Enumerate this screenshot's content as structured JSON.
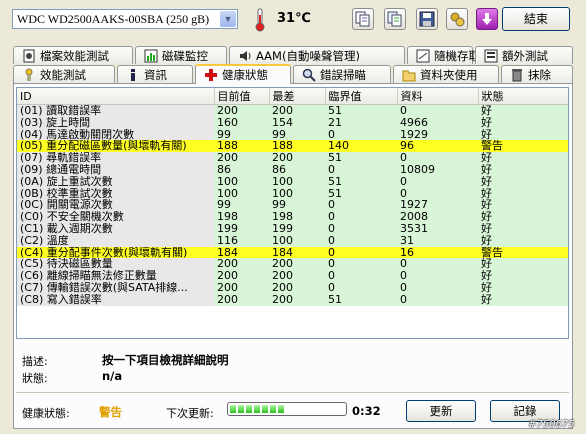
{
  "toolbar": {
    "drive": "WDC WD2500AAKS-00SBA     (250 gB)",
    "temperature": "31℃",
    "exit_label": "結束"
  },
  "tabs_row1": [
    {
      "label": "檔案效能測試",
      "icon": "file-speed-icon"
    },
    {
      "label": "磁碟監控",
      "icon": "disk-monitor-icon"
    },
    {
      "label": "AAM(自動噪聲管理)",
      "icon": "speaker-icon"
    },
    {
      "label": "隨機存取",
      "icon": "random-access-icon"
    },
    {
      "label": "額外測試",
      "icon": "extra-test-icon"
    }
  ],
  "tabs_row2": [
    {
      "label": "效能測試",
      "icon": "benchmark-icon"
    },
    {
      "label": "資訊",
      "icon": "info-icon"
    },
    {
      "label": "健康狀態",
      "icon": "health-cross-icon"
    },
    {
      "label": "錯誤掃瞄",
      "icon": "error-scan-icon"
    },
    {
      "label": "資料夾使用",
      "icon": "folder-usage-icon"
    },
    {
      "label": "抹除",
      "icon": "erase-icon"
    }
  ],
  "columns": [
    "ID",
    "目前值",
    "最差",
    "臨界值",
    "資料",
    "狀態"
  ],
  "rows": [
    {
      "id": "(01) 讀取錯誤率",
      "cur": "200",
      "worst": "200",
      "thr": "51",
      "data": "0",
      "status": "好"
    },
    {
      "id": "(03) 旋上時間",
      "cur": "160",
      "worst": "154",
      "thr": "21",
      "data": "4966",
      "status": "好"
    },
    {
      "id": "(04) 馬達啟動關閉次數",
      "cur": "99",
      "worst": "99",
      "thr": "0",
      "data": "1929",
      "status": "好"
    },
    {
      "id": "(05) 重分配磁區數量(與壞軌有關)",
      "cur": "188",
      "worst": "188",
      "thr": "140",
      "data": "96",
      "status": "警告",
      "warn": true
    },
    {
      "id": "(07) 尋軌錯誤率",
      "cur": "200",
      "worst": "200",
      "thr": "51",
      "data": "0",
      "status": "好"
    },
    {
      "id": "(09) 總通電時間",
      "cur": "86",
      "worst": "86",
      "thr": "0",
      "data": "10809",
      "status": "好"
    },
    {
      "id": "(0A) 旋上重試次數",
      "cur": "100",
      "worst": "100",
      "thr": "51",
      "data": "0",
      "status": "好"
    },
    {
      "id": "(0B) 校準重試次數",
      "cur": "100",
      "worst": "100",
      "thr": "51",
      "data": "0",
      "status": "好"
    },
    {
      "id": "(0C) 開關電源次數",
      "cur": "99",
      "worst": "99",
      "thr": "0",
      "data": "1927",
      "status": "好"
    },
    {
      "id": "(C0) 不安全關機次數",
      "cur": "198",
      "worst": "198",
      "thr": "0",
      "data": "2008",
      "status": "好"
    },
    {
      "id": "(C1) 載入週期次數",
      "cur": "199",
      "worst": "199",
      "thr": "0",
      "data": "3531",
      "status": "好"
    },
    {
      "id": "(C2) 溫度",
      "cur": "116",
      "worst": "100",
      "thr": "0",
      "data": "31",
      "status": "好"
    },
    {
      "id": "(C4) 重分配事件次數(與壞軌有關)",
      "cur": "184",
      "worst": "184",
      "thr": "0",
      "data": "16",
      "status": "警告",
      "warn": true
    },
    {
      "id": "(C5) 待決磁區數量",
      "cur": "200",
      "worst": "200",
      "thr": "0",
      "data": "0",
      "status": "好"
    },
    {
      "id": "(C6) 離線掃瞄無法修正數量",
      "cur": "200",
      "worst": "200",
      "thr": "0",
      "data": "0",
      "status": "好"
    },
    {
      "id": "(C7) 傳輸錯誤次數(與SATA排線...",
      "cur": "200",
      "worst": "200",
      "thr": "0",
      "data": "0",
      "status": "好"
    },
    {
      "id": "(C8) 寫入錯誤率",
      "cur": "200",
      "worst": "200",
      "thr": "51",
      "data": "0",
      "status": "好"
    }
  ],
  "detail": {
    "desc_label": "描述:",
    "desc_value": "按一下項目檢視詳細說明",
    "state_label": "狀態:",
    "state_value": "n/a"
  },
  "footer": {
    "health_label": "健康狀態:",
    "health_value": "警告",
    "next_update_label": "下次更新:",
    "progress_fraction": 0.8,
    "countdown": "0:32",
    "refresh_label": "更新",
    "log_label": "記錄"
  },
  "watermark": "#750675",
  "colors": {
    "warn_row": "#ffff22",
    "good_cell": "#d8f5d8",
    "health_warn": "#e0a000"
  }
}
